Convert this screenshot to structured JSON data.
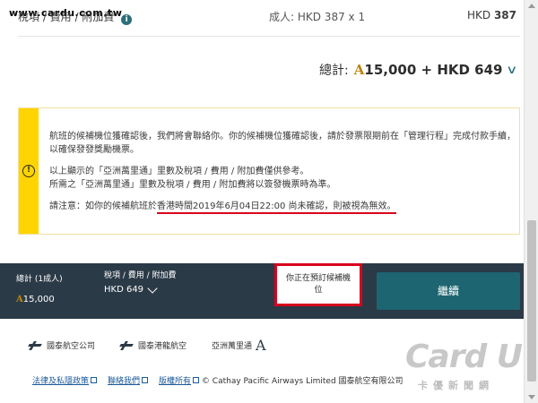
{
  "watermark_url": "www.cardu.com.tw",
  "fare": {
    "label": "稅項 / 費用 / 附加費",
    "info_icon": "i",
    "adult": "成人: HKD 387 x 1",
    "currency": "HKD",
    "amount": "387"
  },
  "total": {
    "label": "總計:",
    "miles_symbol": "A",
    "miles": "15,000",
    "plus_amount": "+ HKD 649",
    "chevron": "∨"
  },
  "notice": {
    "icon": "!",
    "para1": "航班的候補機位獲確認後，我們將會聯絡你。你的候補機位獲確認後，請於發票限期前在「管理行程」完成付款手續，以確保發發獎勵機票。",
    "para2_line1": "以上顯示的「亞洲萬里通」里數及稅項 / 費用 / 附加費僅供參考。",
    "para2_line2": "所需之「亞洲萬里通」里數及稅項 / 費用 / 附加費將以簽發機票時為準。",
    "para3_prefix": "請注意：如你的候補航班於",
    "para3_highlight": "香港時間2019年6月04日22:00 尚未確認，則被視為無效。"
  },
  "bottom_bar": {
    "total_label": "總計 (1成人)",
    "total_value": "15,000",
    "tax_label": "稅項 / 費用 / 附加費",
    "tax_value": "HKD 649",
    "booking_note": "你正在預訂候補機位",
    "continue_label": "繼續"
  },
  "logos": {
    "cathay": "國泰航空公司",
    "dragon": "國泰港龍航空",
    "asiamiles": "亞洲萬里通"
  },
  "footer": {
    "privacy": "法律及私隱政策",
    "contact": "聯絡我們",
    "copyright_link": "版權所有",
    "copyright": "© Cathay Pacific Airways Limited 國泰航空有限公司"
  },
  "brand_watermark": {
    "name": "Card U",
    "subtitle": "卡優新聞網"
  },
  "colors": {
    "accent_teal": "#1d6570",
    "dark_bar": "#2b3a47",
    "notice_yellow": "#ffd400",
    "highlight_red": "#d8001c"
  }
}
